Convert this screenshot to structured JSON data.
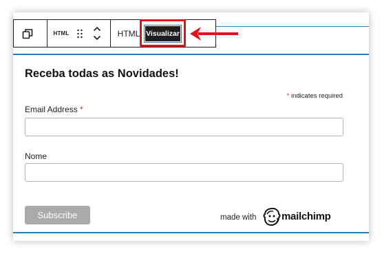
{
  "toolbar": {
    "html_block_icon_label": "HTML",
    "tab_html": "HTML",
    "tab_preview": "Visualizar"
  },
  "form": {
    "title": "Receba todas as Novidades!",
    "required_star": "*",
    "required_note": "indicates required",
    "email_label": "Email Address",
    "email_value": "",
    "name_label": "Nome",
    "name_value": "",
    "subscribe_label": "Subscribe",
    "made_with": "made with",
    "brand": "mailchimp"
  },
  "colors": {
    "annotation_red": "#e0141c",
    "editor_blue": "#2a7ab8",
    "button_gray": "#aaaaaa",
    "required_red": "#c0392b"
  },
  "icons": {
    "block_switcher": "duplicate-icon",
    "html_block": "html-icon",
    "drag": "drag-handle-icon",
    "move_up": "chevron-up-icon",
    "move_down": "chevron-down-icon",
    "annotation": "arrow-left-icon"
  }
}
